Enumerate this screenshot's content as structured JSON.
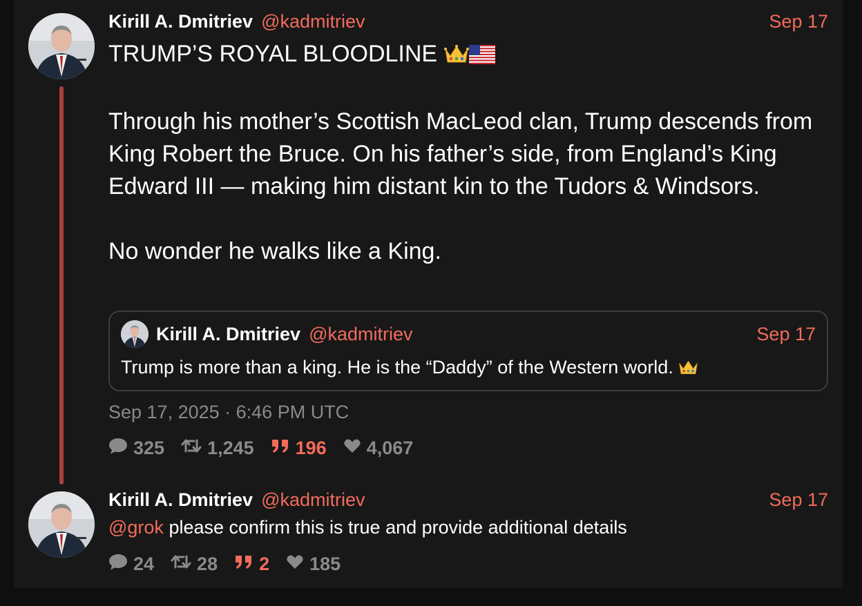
{
  "colors": {
    "background": "#181818",
    "accent": "#f26b5b",
    "muted": "#8a8a8a",
    "thread_line": "#a8403d"
  },
  "main_tweet": {
    "author_name": "Kirill A. Dmitriev",
    "handle": "@kadmitriev",
    "date": "Sep 17",
    "headline": "TRUMP’S ROYAL BLOODLINE",
    "paragraph1": "Through his mother’s Scottish MacLeod clan, Trump descends from King Robert the Bruce. On his father’s side, from England’s King Edward III — making him distant kin to the Tudors & Windsors.",
    "paragraph2": "No wonder he walks like a King.",
    "timestamp": "Sep 17, 2025 · 6:46 PM UTC",
    "stats": {
      "replies": "325",
      "retweets": "1,245",
      "quotes": "196",
      "likes": "4,067"
    }
  },
  "quoted_tweet": {
    "author_name": "Kirill A. Dmitriev",
    "handle": "@kadmitriev",
    "date": "Sep 17",
    "text": "Trump is more than a king. He is the “Daddy” of the Western world."
  },
  "reply_tweet": {
    "author_name": "Kirill A. Dmitriev",
    "handle": "@kadmitriev",
    "date": "Sep 17",
    "mention": "@grok",
    "text": " please confirm this is true and provide additional details",
    "stats": {
      "replies": "24",
      "retweets": "28",
      "quotes": "2",
      "likes": "185"
    }
  },
  "icons": [
    "comment-icon",
    "retweet-icon",
    "quote-icon",
    "heart-icon",
    "crown-emoji",
    "us-flag-emoji"
  ]
}
